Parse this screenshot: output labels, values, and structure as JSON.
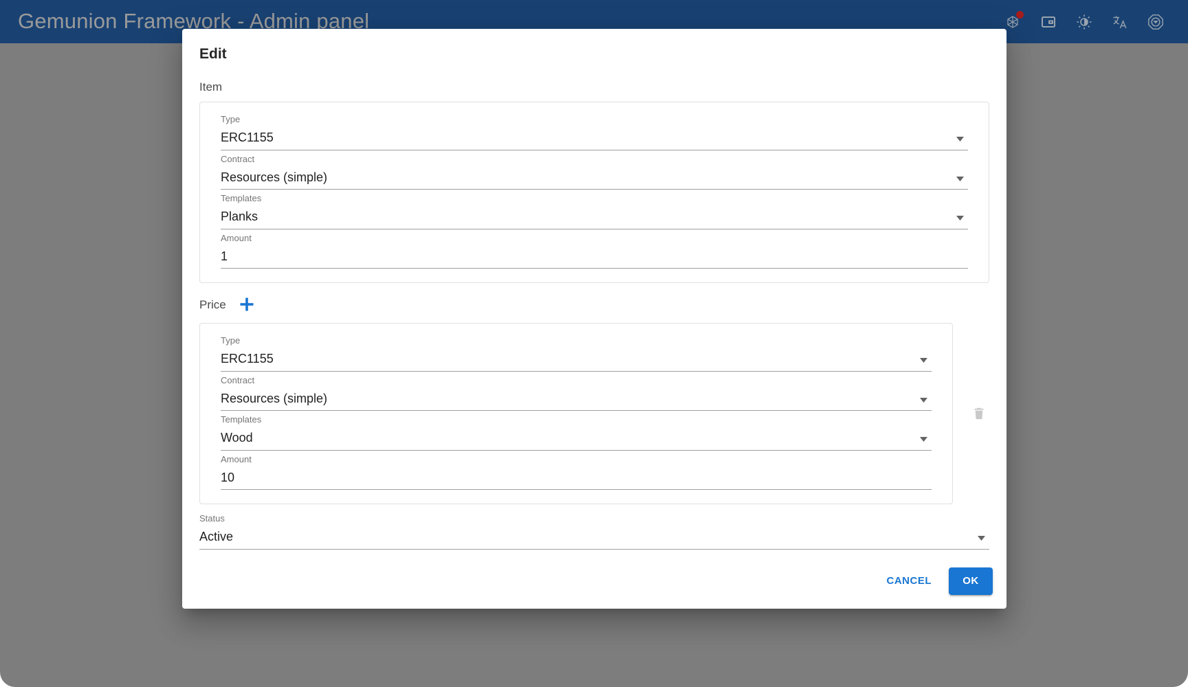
{
  "appbar": {
    "title": "Gemunion Framework - Admin panel",
    "icons": [
      {
        "name": "network-graph-icon",
        "badge": true
      },
      {
        "name": "wallet-icon",
        "badge": false
      },
      {
        "name": "brightness-contrast-icon",
        "badge": false
      },
      {
        "name": "translate-icon",
        "badge": false
      },
      {
        "name": "octagon-badge-icon",
        "badge": false
      }
    ]
  },
  "dialog": {
    "title": "Edit",
    "sections": {
      "item": {
        "heading": "Item",
        "fields": [
          {
            "label": "Type",
            "value": "ERC1155",
            "control": "select"
          },
          {
            "label": "Contract",
            "value": "Resources (simple)",
            "control": "select"
          },
          {
            "label": "Templates",
            "value": "Planks",
            "control": "select"
          },
          {
            "label": "Amount",
            "value": "1",
            "control": "text"
          }
        ]
      },
      "price": {
        "heading": "Price",
        "add_label": "add-price",
        "delete_label": "delete-price",
        "fields": [
          {
            "label": "Type",
            "value": "ERC1155",
            "control": "select"
          },
          {
            "label": "Contract",
            "value": "Resources (simple)",
            "control": "select"
          },
          {
            "label": "Templates",
            "value": "Wood",
            "control": "select"
          },
          {
            "label": "Amount",
            "value": "10",
            "control": "text"
          }
        ]
      }
    },
    "status": {
      "label": "Status",
      "value": "Active",
      "control": "select"
    },
    "actions": {
      "cancel": "CANCEL",
      "ok": "OK"
    }
  },
  "colors": {
    "appbar": "#194273",
    "primary": "#1976d2",
    "notification": "#a61d1d",
    "label": "#757575",
    "value": "#1f1f1f",
    "disabled_icon": "#c9c9c9"
  }
}
